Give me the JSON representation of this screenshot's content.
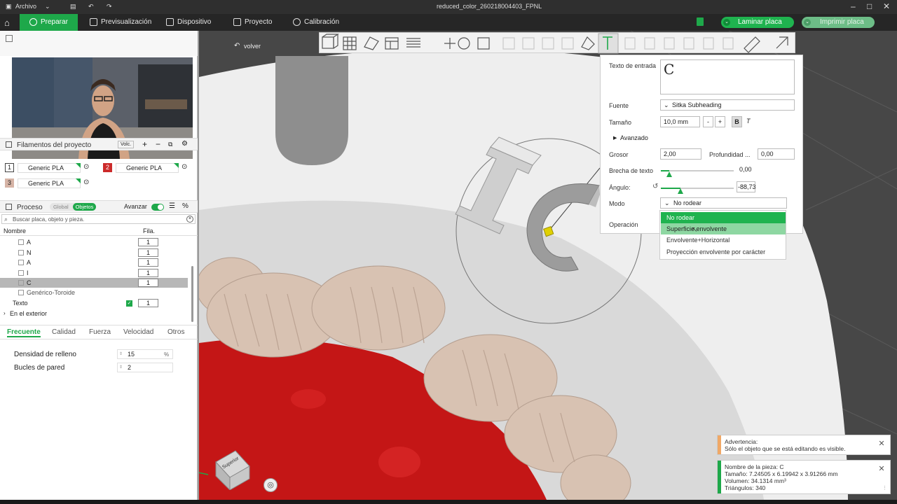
{
  "titlebar": {
    "menu_label": "Archivo",
    "file_title": "reduced_color_260218004403_FPNL",
    "minimize": "–",
    "maximize": "□",
    "close": "✕"
  },
  "nav": {
    "tabs": [
      {
        "label": "Preparar"
      },
      {
        "label": "Previsualización"
      },
      {
        "label": "Dispositivo"
      },
      {
        "label": "Proyecto"
      },
      {
        "label": "Calibración"
      }
    ],
    "slice_button": "Laminar placa",
    "print_button": "Imprimir placa"
  },
  "filaments": {
    "title": "Filamentos del proyecto",
    "volc_label": "Volc.",
    "items": [
      {
        "num": "1",
        "name": "Generic PLA",
        "color": "#ffffff"
      },
      {
        "num": "2",
        "name": "Generic PLA",
        "color": "#cc2b2b"
      },
      {
        "num": "3",
        "name": "Generic PLA",
        "color": "#d6b4a6"
      }
    ]
  },
  "process": {
    "title": "Proceso",
    "global_label": "Global",
    "objects_label": "Objetos",
    "advanced_label": "Avanzar",
    "search_placeholder": "Buscar placa, objeto y pieza.",
    "col_name": "Nombre",
    "col_fil": "Fila.",
    "rows": [
      {
        "name": "A",
        "qty": "1"
      },
      {
        "name": "N",
        "qty": "1"
      },
      {
        "name": "A",
        "qty": "1"
      },
      {
        "name": "I",
        "qty": "1"
      },
      {
        "name": "C",
        "qty": "1"
      },
      {
        "name": "Genérico-Toroide",
        "qty": ""
      }
    ],
    "text_row": {
      "name": "Texto",
      "qty": "1"
    },
    "exterior_label": "En el exterior"
  },
  "settings_tabs": [
    "Frecuente",
    "Calidad",
    "Fuerza",
    "Velocidad",
    "Otros"
  ],
  "settings": {
    "infill_label": "Densidad de relleno",
    "infill_value": "15",
    "infill_unit": "%",
    "walls_label": "Bucles de pared",
    "walls_value": "2"
  },
  "viewport": {
    "back_label": "volver",
    "cube_label": "Superior",
    "colors": {
      "plate": "#ececec",
      "gum": "#c41616",
      "tooth": "#d8c2b2"
    }
  },
  "text_panel": {
    "input_label": "Texto de entrada",
    "input_value": "C",
    "font_label": "Fuente",
    "font_value": "Sitka Subheading",
    "size_label": "Tamaño",
    "size_value": "10,0 mm",
    "minus": "-",
    "plus": "+",
    "bold": "B",
    "italic": "T",
    "advanced_label": "Avanzado",
    "thickness_label": "Grosor",
    "thickness_value": "2,00",
    "depth_label": "Profundidad ...",
    "depth_value": "0,00",
    "gap_label": "Brecha de texto",
    "gap_value": "0,00",
    "angle_label": "Ángulo:",
    "angle_value": "-88,73",
    "mode_label": "Modo",
    "mode_value": "No rodear",
    "operation_label": "Operación",
    "mode_options": [
      "No rodear",
      "Superficie envolvente",
      "Envolvente+Horizontal",
      "Proyección envolvente por carácter"
    ]
  },
  "notifications": {
    "warning_title": "Advertencia:",
    "warning_text": "Sólo el objeto que se está editando es visible.",
    "part_name": "Nombre de la pieza: C",
    "part_size": "Tamaño: 7.24505 x 6.19942 x 3.91266 mm",
    "part_volume": "Volumen: 34.1314 mm³",
    "part_triangles": "Triángulos: 340"
  }
}
